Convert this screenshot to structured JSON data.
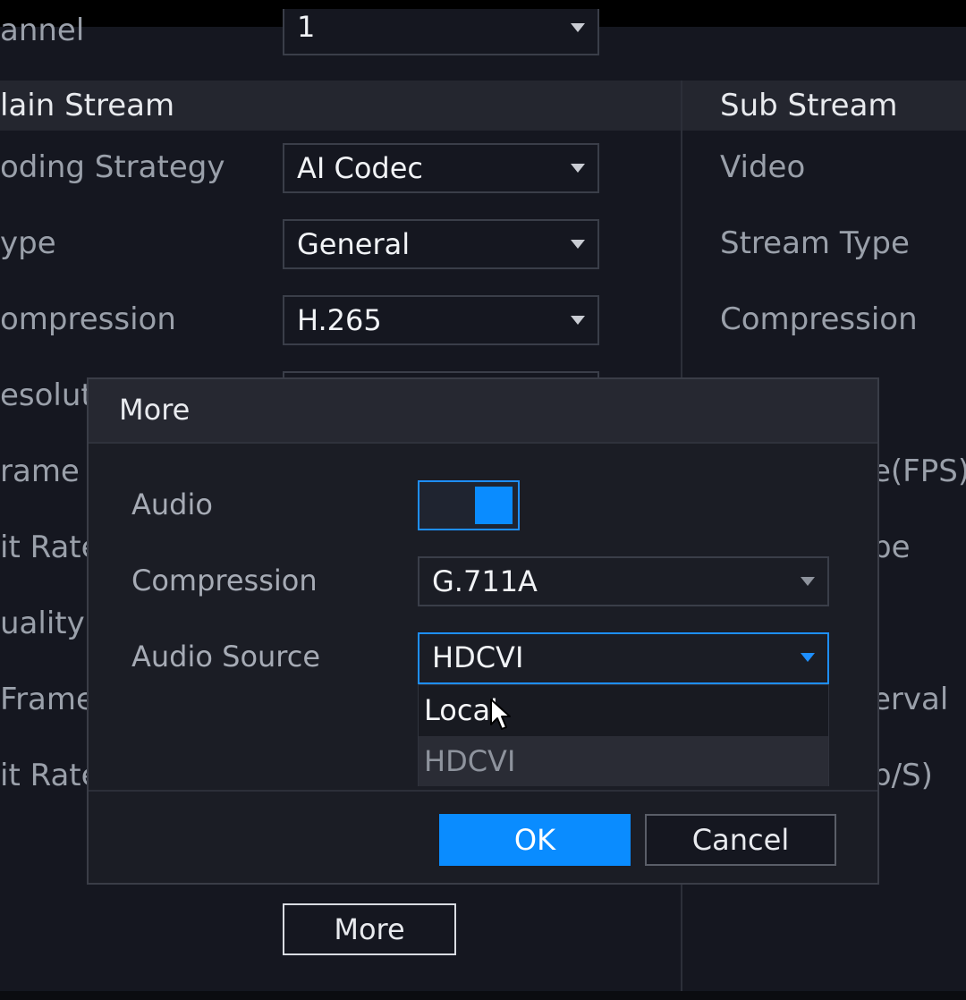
{
  "main_stream": {
    "channel_label": "annel",
    "channel_value": "1",
    "header": "lain Stream",
    "rows": [
      {
        "label": "oding Strategy",
        "value": "AI Codec"
      },
      {
        "label": "ype",
        "value": "General"
      },
      {
        "label": "ompression",
        "value": "H.265"
      },
      {
        "label": "esolut"
      },
      {
        "label": "rame R"
      },
      {
        "label": "it Rate"
      },
      {
        "label": "uality"
      },
      {
        "label": "Frame"
      },
      {
        "label": "it Rate"
      }
    ],
    "more_button": "More"
  },
  "sub_stream": {
    "header": "Sub Stream",
    "labels": [
      "Video",
      "Stream Type",
      "Compression",
      "e(FPS)",
      "pe",
      "erval",
      "b/S)"
    ]
  },
  "modal": {
    "title": "More",
    "audio_label": "Audio",
    "audio_enabled": true,
    "compression_label": "Compression",
    "compression_value": "G.711A",
    "audio_source_label": "Audio Source",
    "audio_source_value": "HDCVI",
    "audio_source_options": [
      "Local",
      "HDCVI"
    ],
    "ok_label": "OK",
    "cancel_label": "Cancel"
  },
  "colors": {
    "accent": "#0a8cff",
    "background": "#151720",
    "modal_background": "#1b1d25"
  }
}
